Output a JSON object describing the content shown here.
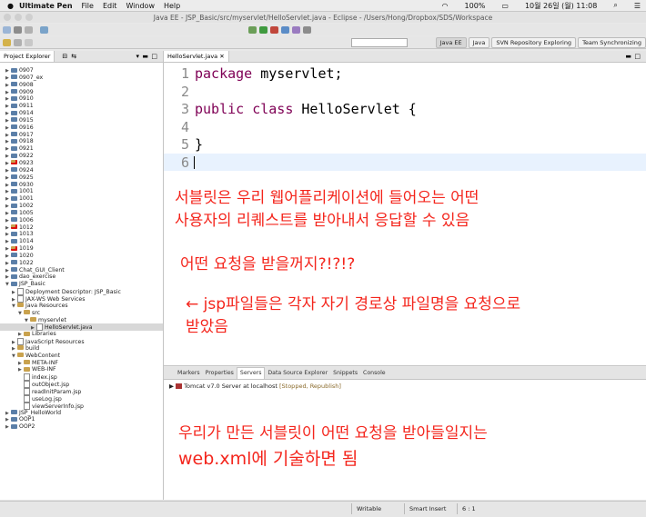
{
  "menubar": {
    "apple": "",
    "app_name": "Ultimate Pen",
    "items": [
      "File",
      "Edit",
      "Window",
      "Help"
    ],
    "battery": "100%",
    "datetime": "10월 26일 (월) 11:08"
  },
  "window": {
    "title": "Java EE - JSP_Basic/src/myservlet/HelloServlet.java - Eclipse - /Users/Hong/Dropbox/SDS/Workspace"
  },
  "perspectives": [
    "Java EE",
    "Java",
    "SVN Repository Exploring",
    "Team Synchronizing"
  ],
  "explorer": {
    "tab_label": "Project Explorer",
    "rows": [
      {
        "depth": 0,
        "twisty": "▶",
        "kind": "proj",
        "label": "0907"
      },
      {
        "depth": 0,
        "twisty": "▶",
        "kind": "proj",
        "label": "0907_ex"
      },
      {
        "depth": 0,
        "twisty": "▶",
        "kind": "proj",
        "label": "0908"
      },
      {
        "depth": 0,
        "twisty": "▶",
        "kind": "proj",
        "label": "0909"
      },
      {
        "depth": 0,
        "twisty": "▶",
        "kind": "proj",
        "label": "0910"
      },
      {
        "depth": 0,
        "twisty": "▶",
        "kind": "proj",
        "label": "0911"
      },
      {
        "depth": 0,
        "twisty": "▶",
        "kind": "proj",
        "label": "0914"
      },
      {
        "depth": 0,
        "twisty": "▶",
        "kind": "proj",
        "label": "0915"
      },
      {
        "depth": 0,
        "twisty": "▶",
        "kind": "proj",
        "label": "0916"
      },
      {
        "depth": 0,
        "twisty": "▶",
        "kind": "proj",
        "label": "0917"
      },
      {
        "depth": 0,
        "twisty": "▶",
        "kind": "proj",
        "label": "0918"
      },
      {
        "depth": 0,
        "twisty": "▶",
        "kind": "proj",
        "label": "0921"
      },
      {
        "depth": 0,
        "twisty": "▶",
        "kind": "proj",
        "label": "0922"
      },
      {
        "depth": 0,
        "twisty": "▶",
        "kind": "err",
        "label": "0923"
      },
      {
        "depth": 0,
        "twisty": "▶",
        "kind": "proj",
        "label": "0924"
      },
      {
        "depth": 0,
        "twisty": "▶",
        "kind": "proj",
        "label": "0925"
      },
      {
        "depth": 0,
        "twisty": "▶",
        "kind": "proj",
        "label": "0930"
      },
      {
        "depth": 0,
        "twisty": "▶",
        "kind": "proj",
        "label": "1001"
      },
      {
        "depth": 0,
        "twisty": "▶",
        "kind": "proj",
        "label": "1001"
      },
      {
        "depth": 0,
        "twisty": "▶",
        "kind": "proj",
        "label": "1002"
      },
      {
        "depth": 0,
        "twisty": "▶",
        "kind": "proj",
        "label": "1005"
      },
      {
        "depth": 0,
        "twisty": "▶",
        "kind": "proj",
        "label": "1006"
      },
      {
        "depth": 0,
        "twisty": "▶",
        "kind": "err",
        "label": "1012"
      },
      {
        "depth": 0,
        "twisty": "▶",
        "kind": "proj",
        "label": "1013"
      },
      {
        "depth": 0,
        "twisty": "▶",
        "kind": "proj",
        "label": "1014"
      },
      {
        "depth": 0,
        "twisty": "▶",
        "kind": "err",
        "label": "1019"
      },
      {
        "depth": 0,
        "twisty": "▶",
        "kind": "proj",
        "label": "1020"
      },
      {
        "depth": 0,
        "twisty": "▶",
        "kind": "proj",
        "label": "1022"
      },
      {
        "depth": 0,
        "twisty": "▶",
        "kind": "proj",
        "label": "Chat_GUI_Client"
      },
      {
        "depth": 0,
        "twisty": "▶",
        "kind": "proj",
        "label": "dao_exercise"
      },
      {
        "depth": 0,
        "twisty": "▼",
        "kind": "proj",
        "label": "JSP_Basic"
      },
      {
        "depth": 1,
        "twisty": "▶",
        "kind": "fil",
        "label": "Deployment Descriptor: JSP_Basic"
      },
      {
        "depth": 1,
        "twisty": "▶",
        "kind": "fil",
        "label": "JAX-WS Web Services"
      },
      {
        "depth": 1,
        "twisty": "▼",
        "kind": "fld",
        "label": "Java Resources"
      },
      {
        "depth": 2,
        "twisty": "▼",
        "kind": "fld",
        "label": "src"
      },
      {
        "depth": 3,
        "twisty": "▼",
        "kind": "fld",
        "label": "myservlet"
      },
      {
        "depth": 4,
        "twisty": "▶",
        "kind": "fil",
        "label": "HelloServlet.java",
        "selected": true
      },
      {
        "depth": 2,
        "twisty": "▶",
        "kind": "fld",
        "label": "Libraries"
      },
      {
        "depth": 1,
        "twisty": "▶",
        "kind": "fil",
        "label": "JavaScript Resources"
      },
      {
        "depth": 1,
        "twisty": "▶",
        "kind": "fld",
        "label": "build"
      },
      {
        "depth": 1,
        "twisty": "▼",
        "kind": "fld",
        "label": "WebContent"
      },
      {
        "depth": 2,
        "twisty": "▶",
        "kind": "fld",
        "label": "META-INF"
      },
      {
        "depth": 2,
        "twisty": "▶",
        "kind": "fld",
        "label": "WEB-INF"
      },
      {
        "depth": 2,
        "twisty": "",
        "kind": "fil",
        "label": "index.jsp"
      },
      {
        "depth": 2,
        "twisty": "",
        "kind": "fil",
        "label": "outObject.jsp"
      },
      {
        "depth": 2,
        "twisty": "",
        "kind": "fil",
        "label": "readInitParam.jsp"
      },
      {
        "depth": 2,
        "twisty": "",
        "kind": "fil",
        "label": "useLog.jsp"
      },
      {
        "depth": 2,
        "twisty": "",
        "kind": "fil",
        "label": "viewServerInfo.jsp"
      },
      {
        "depth": 0,
        "twisty": "▶",
        "kind": "proj",
        "label": "JSP_HelloWorld"
      },
      {
        "depth": 0,
        "twisty": "▶",
        "kind": "proj",
        "label": "OOP1"
      },
      {
        "depth": 0,
        "twisty": "▶",
        "kind": "proj",
        "label": "OOP2"
      }
    ]
  },
  "editor": {
    "tab_label": "HelloServlet.java",
    "line_numbers": [
      "1",
      "2",
      "3",
      "4",
      "5",
      "6"
    ],
    "line1_kw": "package",
    "line1_rest": " myservlet;",
    "line3_kw1": "public",
    "line3_kw2": "class",
    "line3_rest": " HelloServlet {",
    "line5": "}"
  },
  "annotations": {
    "a1_line1": "서블릿은 우리 웹어플리케이션에 들어오는 어떤",
    "a1_line2": "사용자의 리퀘스트를 받아내서 응답할 수 있음",
    "a2": "어떤 요청을 받을꺼지?!?!?",
    "a3_line1": "← jsp파일들은 각자 자기 경로상 파일명을 요청으로",
    "a3_line2": "받았음",
    "a4_line1": "우리가 만든 서블릿이 어떤 요청을 받아들일지는",
    "a4_line2": "web.xml에 기술하면 됨"
  },
  "console": {
    "tabs": [
      "Markers",
      "Properties",
      "Servers",
      "Data Source Explorer",
      "Snippets",
      "Console"
    ],
    "active_tab": "Servers",
    "server_name": "Tomcat v7.0 Server at localhost",
    "server_status": "[Stopped, Republish]"
  },
  "statusbar": {
    "writable": "Writable",
    "insert_mode": "Smart Insert",
    "position": "6 : 1"
  },
  "colors": {
    "annotation": "#f4251c",
    "keyword": "#7f0055",
    "current_line": "#e8f2fe"
  }
}
